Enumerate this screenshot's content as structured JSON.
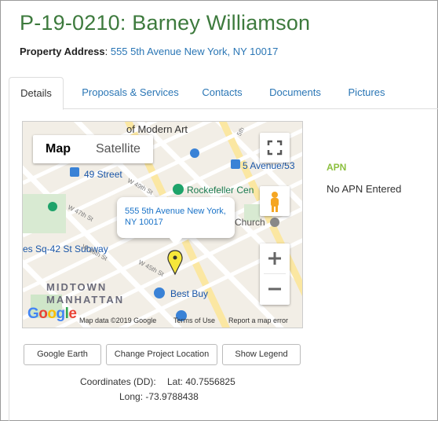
{
  "header": {
    "title": "P-19-0210: Barney Williamson",
    "address_label": "Property Address",
    "address_value": "555 5th Avenue New York, NY 10017"
  },
  "tabs": [
    {
      "label": "Details"
    },
    {
      "label": "Proposals & Services"
    },
    {
      "label": "Contacts"
    },
    {
      "label": "Documents"
    },
    {
      "label": "Pictures"
    }
  ],
  "map": {
    "type_map": "Map",
    "type_satellite": "Satellite",
    "info_window": "555 5th Avenue New York, NY 10017",
    "labels": {
      "modern_art": "of Modern Art",
      "st49": "49 Street",
      "ave5_53": "5 Avenue/53",
      "rockefeller": "Rockefeller Cen",
      "church": "Church",
      "sq42": "es Sq-42 St Subway",
      "midtown": "MIDTOWN",
      "manhattan": "MANHATTAN",
      "bestbuy": "Best Buy",
      "w49": "W 49th St",
      "w47": "W 47th St",
      "w46": "W 46th St",
      "w45": "W 45th St",
      "fifth": "5th"
    },
    "attribution": {
      "google": "Google",
      "mapdata": "Map data ©2019 Google",
      "terms": "Terms of Use",
      "report": "Report a map error"
    }
  },
  "apn": {
    "label": "APN",
    "value": "No APN Entered"
  },
  "buttons": {
    "google_earth": "Google Earth",
    "change_location": "Change Project Location",
    "show_legend": "Show Legend"
  },
  "coordinates": {
    "label": "Coordinates (DD):",
    "lat": "Lat: 40.7556825",
    "long": "Long: -73.9788438"
  }
}
